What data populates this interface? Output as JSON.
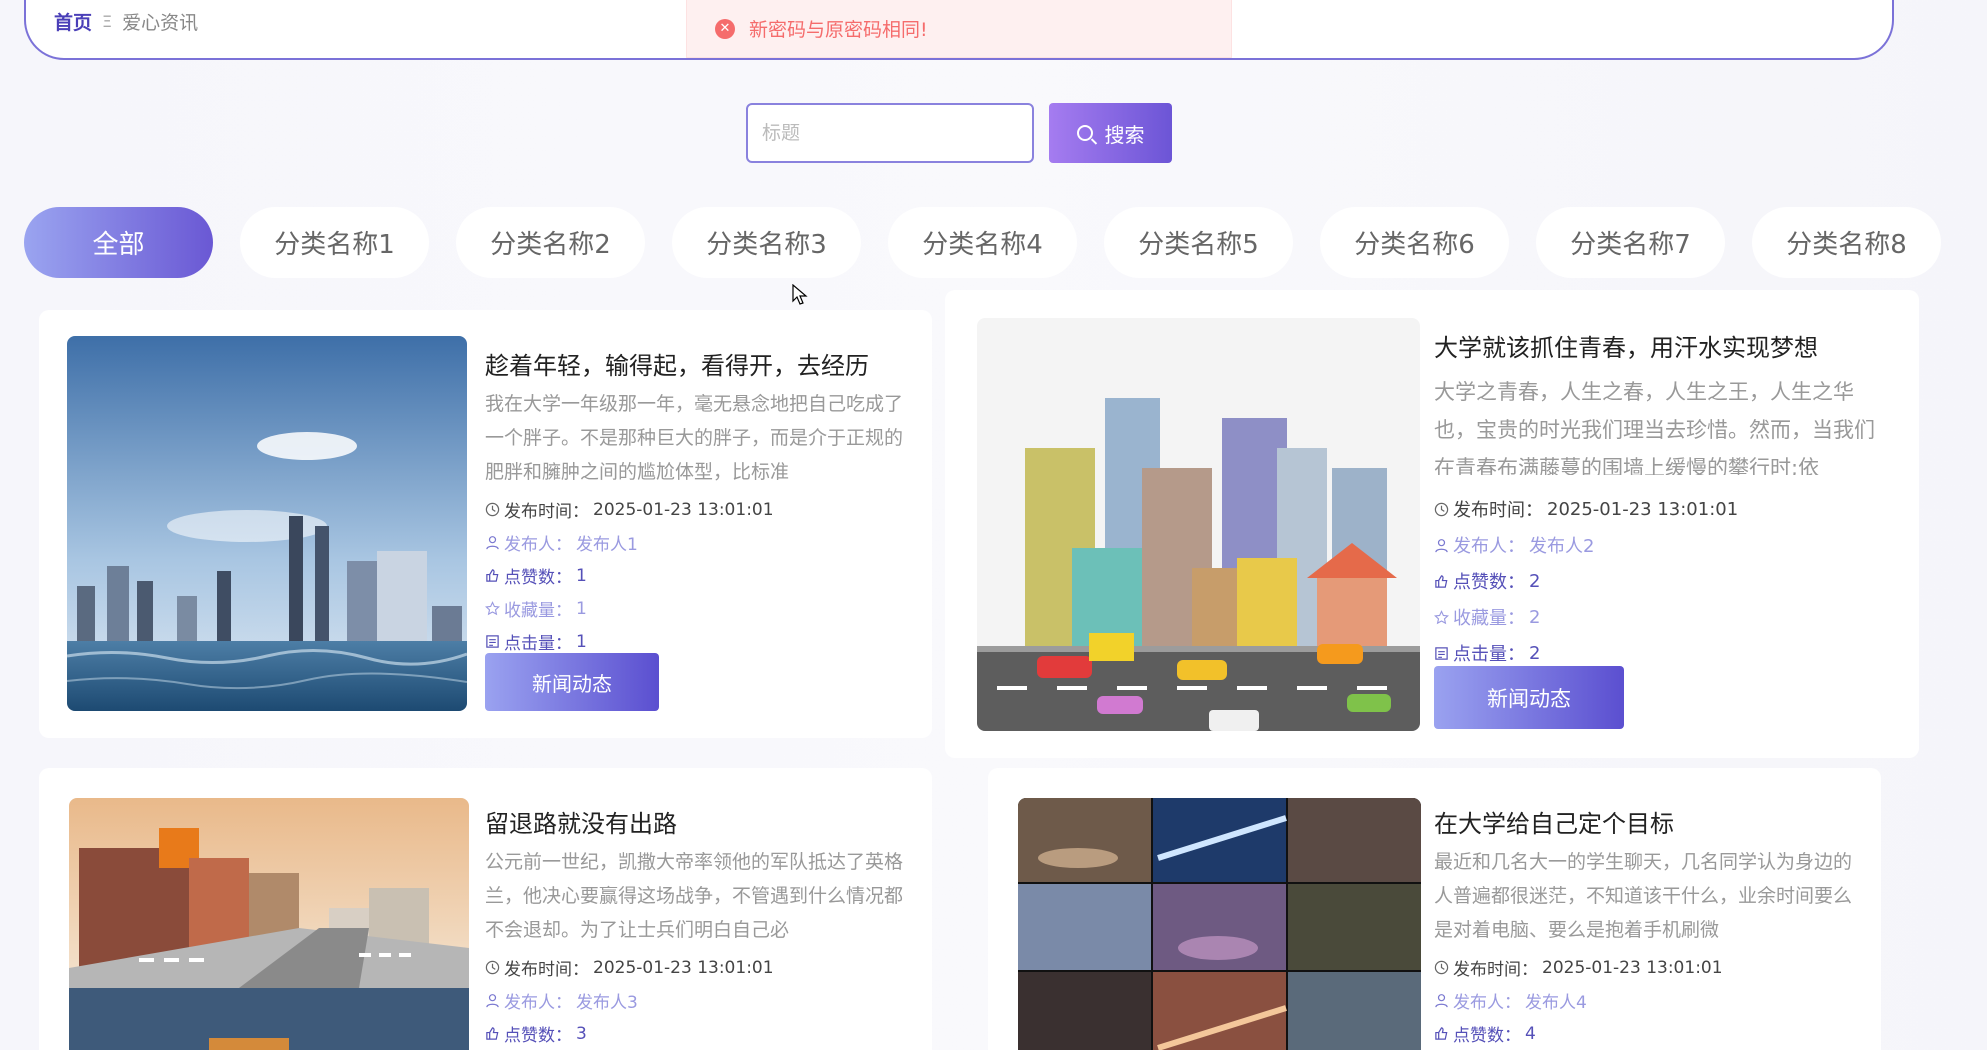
{
  "breadcrumb": {
    "home": "首页",
    "separator": "Ξ",
    "current": "爱心资讯"
  },
  "toast": {
    "message": "新密码与原密码相同!"
  },
  "search": {
    "placeholder": "标题",
    "button_label": "搜索"
  },
  "tabs": [
    "全部",
    "分类名称1",
    "分类名称2",
    "分类名称3",
    "分类名称4",
    "分类名称5",
    "分类名称6",
    "分类名称7",
    "分类名称8"
  ],
  "labels": {
    "time": "发布时间：",
    "publisher": "发布人：",
    "likes": "点赞数：",
    "favorites": "收藏量：",
    "views": "点击量：",
    "tag_button": "新闻动态"
  },
  "cards": [
    {
      "title": "趁着年轻，输得起，看得开，去经历",
      "excerpt": "我在大学一年级那一年，毫无悬念地把自己吃成了一个胖子。不是那种巨大的胖子，而是介于正规的肥胖和臃肿之间的尴尬体型，比标准",
      "time": "2025-01-23 13:01:01",
      "publisher": "发布人1",
      "likes": "1",
      "favorites": "1",
      "views": "1"
    },
    {
      "title": "大学就该抓住青春，用汗水实现梦想",
      "excerpt": "大学之青春，人生之春，人生之王，人生之华也，宝贵的时光我们理当去珍惜。然而，当我们在青春布满藤蔓的围墙上缓慢的攀行时;依",
      "time": "2025-01-23 13:01:01",
      "publisher": "发布人2",
      "likes": "2",
      "favorites": "2",
      "views": "2"
    },
    {
      "title": "留退路就没有出路",
      "excerpt": "公元前一世纪，凯撒大帝率领他的军队抵达了英格兰，他决心要赢得这场战争，不管遇到什么情况都不会退却。为了让士兵们明白自己必",
      "time": "2025-01-23 13:01:01",
      "publisher": "发布人3",
      "likes": "3"
    },
    {
      "title": "在大学给自己定个目标",
      "excerpt": "最近和几名大一的学生聊天，几名同学认为身边的人普遍都很迷茫，不知道该干什么，业余时间要么是对着电脑、要么是抱着手机刷微",
      "time": "2025-01-23 13:01:01",
      "publisher": "发布人4",
      "likes": "4"
    }
  ]
}
